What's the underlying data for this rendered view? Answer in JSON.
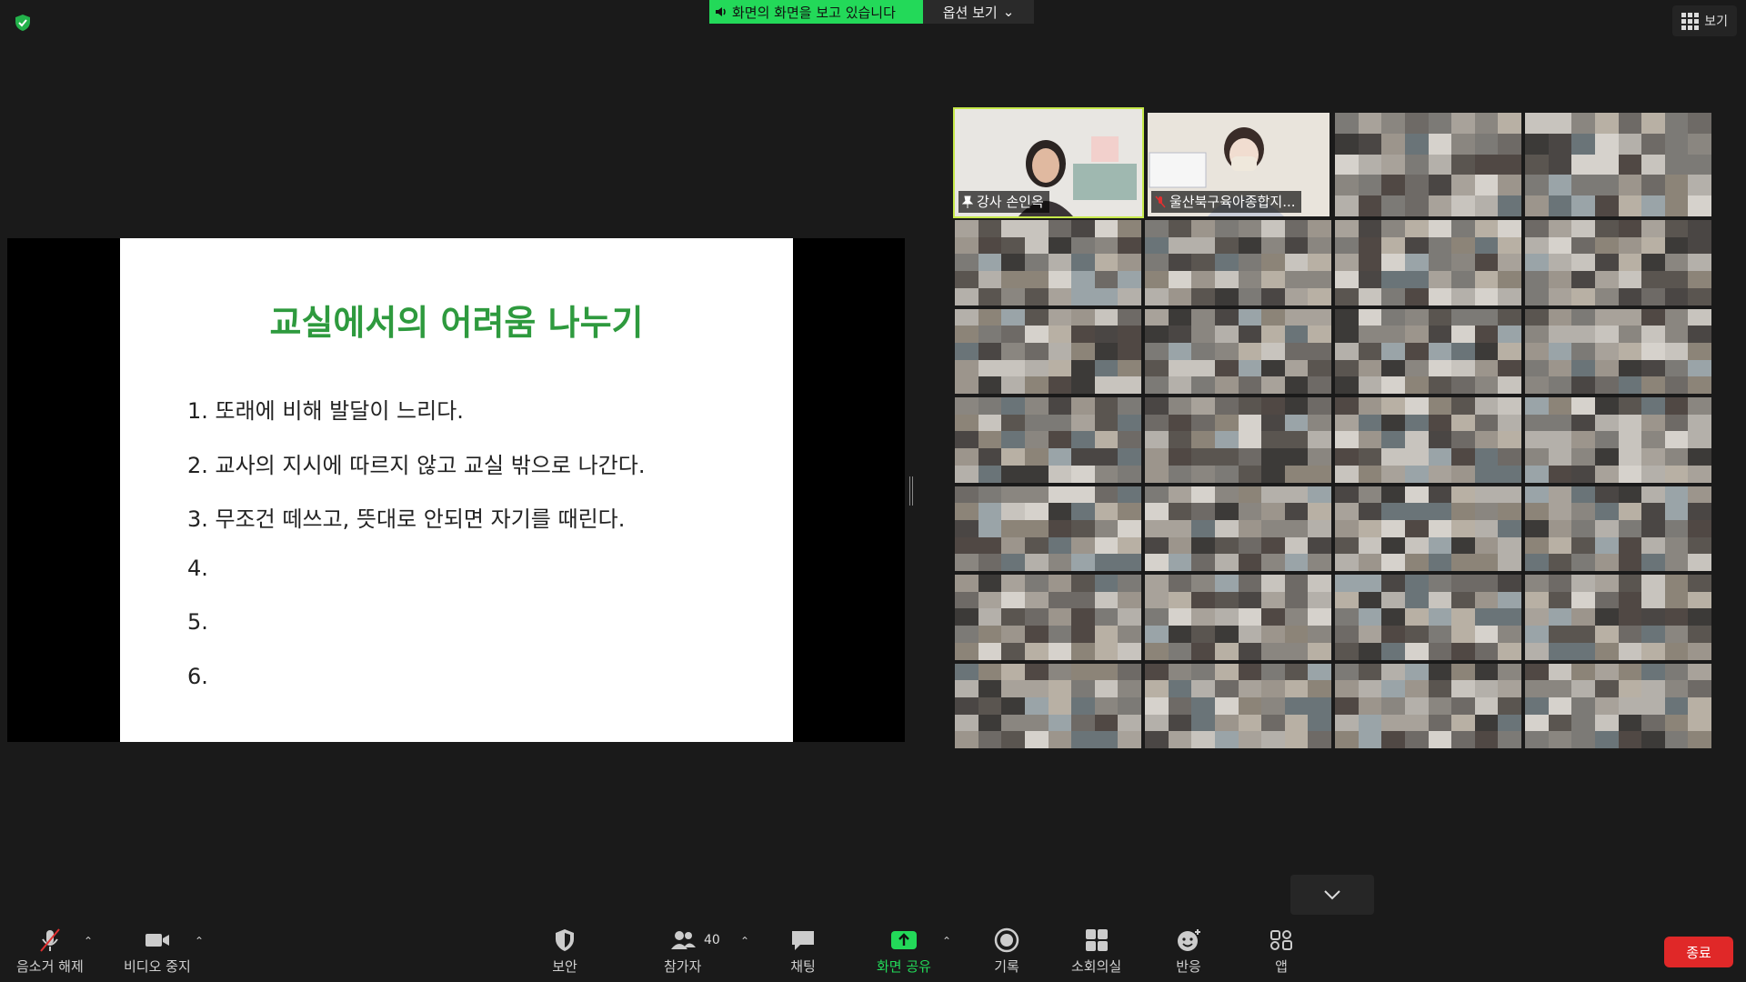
{
  "top": {
    "share_banner": "화면의 화면을 보고 있습니다",
    "options_label": "옵션 보기",
    "view_label": "보기"
  },
  "slide": {
    "title": "교실에서의 어려움 나누기",
    "items": [
      "1. 또래에 비해 발달이 느리다.",
      "2. 교사의 지시에 따르지 않고 교실 밖으로 나간다.",
      "3. 무조건 떼쓰고, 뜻대로 안되면 자기를 때린다.",
      "4.",
      "5.",
      "6."
    ]
  },
  "gallery": {
    "participants": [
      {
        "name": "강사 손인옥"
      },
      {
        "name": "울산북구육아종합지..."
      }
    ]
  },
  "toolbar": {
    "mute": "음소거 해제",
    "video": "비디오 중지",
    "security": "보안",
    "participants": "참가자",
    "participant_count": "40",
    "chat": "채팅",
    "share": "화면 공유",
    "record": "기록",
    "breakout": "소회의실",
    "reactions": "반응",
    "apps": "앱",
    "end": "종료"
  },
  "colors": {
    "accent_green": "#23d959",
    "active_speaker": "#c6e94a",
    "end_red": "#e02828",
    "slide_title": "#2e9a3e"
  }
}
